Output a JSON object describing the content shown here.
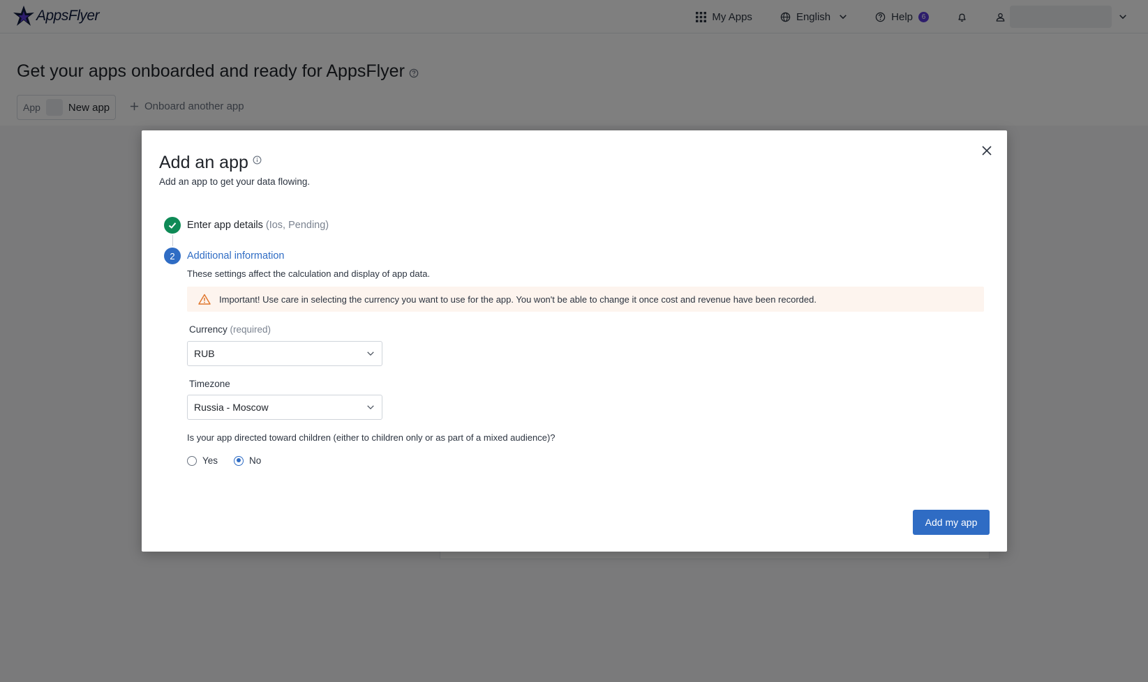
{
  "header": {
    "logo_text": "AppsFlyer",
    "my_apps_label": "My Apps",
    "language_label": "English",
    "help_label": "Help",
    "help_count": "6"
  },
  "page": {
    "title": "Get your apps onboarded and ready for AppsFlyer",
    "app_chip_label": "App",
    "app_chip_name": "New app",
    "onboard_another_label": "Onboard another app"
  },
  "modal": {
    "title": "Add an app",
    "subtitle": "Add an app to get your data flowing.",
    "step1": {
      "label": "Enter app details",
      "detail": "(Ios, Pending)"
    },
    "step2": {
      "number": "2",
      "label": "Additional information"
    },
    "settings_note": "These settings affect the calculation and display of app data.",
    "alert_text": "Important! Use care in selecting the currency you want to use for the app. You won't be able to change it once cost and revenue have been recorded.",
    "currency": {
      "label": "Currency",
      "required": "(required)",
      "value": "RUB"
    },
    "timezone": {
      "label": "Timezone",
      "value": "Russia - Moscow"
    },
    "children_question": "Is your app directed toward children (either to children only or as part of a mixed audience)?",
    "radio_yes": "Yes",
    "radio_no": "No",
    "selected_option": "No",
    "submit_label": "Add my app"
  },
  "colors": {
    "primary": "#2f6cc4",
    "success": "#0e8a56",
    "warning": "#e0782f",
    "badge": "#5b3bd8"
  }
}
